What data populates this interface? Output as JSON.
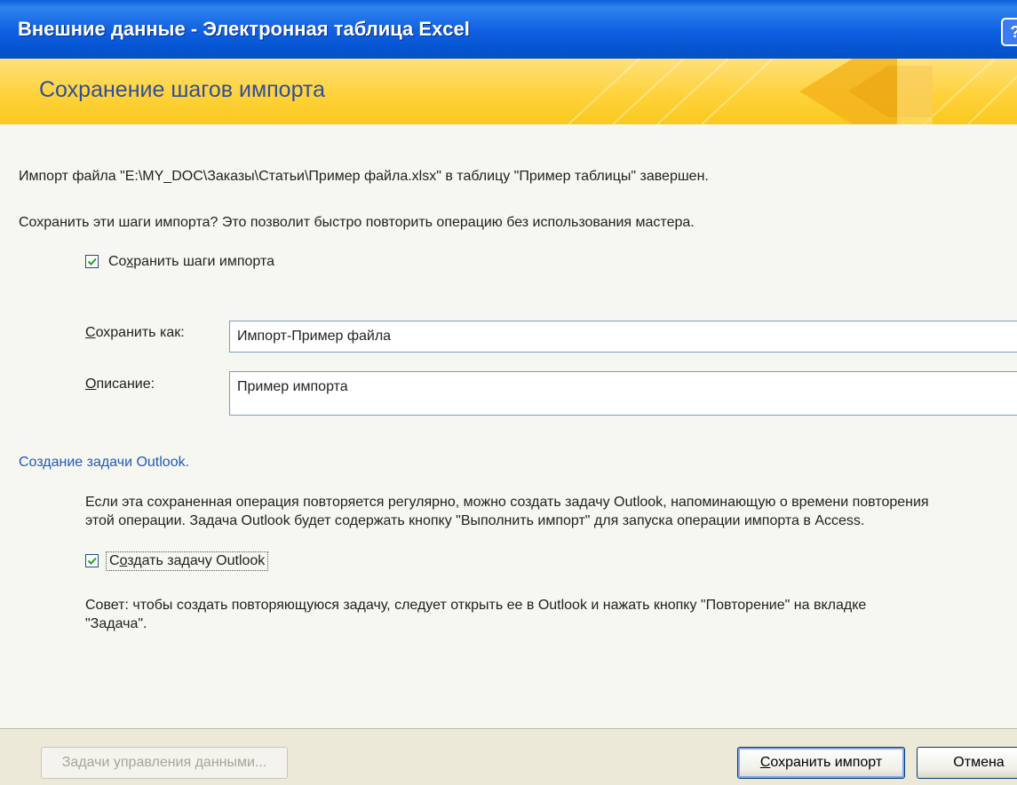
{
  "window": {
    "title": "Внешние данные - Электронная таблица Excel",
    "help_glyph": "?"
  },
  "banner": {
    "heading": "Сохранение шагов импорта"
  },
  "main": {
    "import_done_text": "Импорт файла \"E:\\MY_DOC\\Заказы\\Статьи\\Пример файла.xlsx\" в таблицу \"Пример таблицы\" завершен.",
    "save_question": "Сохранить эти шаги импорта? Это позволит быстро повторить операцию без использования мастера.",
    "save_steps": {
      "label_pre": "Со",
      "label_key": "х",
      "label_post": "ранить шаги импорта",
      "checked": true
    },
    "save_as": {
      "label_key": "С",
      "label_rest": "охранить как:",
      "value": "Импорт-Пример файла"
    },
    "description": {
      "label_key": "О",
      "label_rest": "писание:",
      "value": "Пример импорта"
    },
    "outlook_section_title": "Создание задачи Outlook.",
    "outlook_text_line1": "Если эта сохраненная операция повторяется регулярно, можно создать задачу Outlook, напоминающую о времени повторения",
    "outlook_text_line2": "этой операции. Задача Outlook будет содержать кнопку \"Выполнить импорт\" для запуска операции импорта в Access.",
    "create_task": {
      "label_pre": "С",
      "label_key": "о",
      "label_post": "здать задачу Outlook",
      "checked": true
    },
    "tip_line1": "Совет: чтобы создать повторяющуюся задачу, следует открыть ее в Outlook и нажать кнопку \"Повторение\" на вкладке",
    "tip_line2": "\"Задача\"."
  },
  "footer": {
    "manage_label": "Задачи управления данными...",
    "save_import_pre": "",
    "save_import_key": "С",
    "save_import_rest": "охранить импорт",
    "cancel_label": "Отмена"
  },
  "colors": {
    "title_blue": "#0a5fd8",
    "banner_yellow": "#ffd23b",
    "link_blue": "#1f5ab8",
    "heading_blue": "#2f4f97"
  }
}
